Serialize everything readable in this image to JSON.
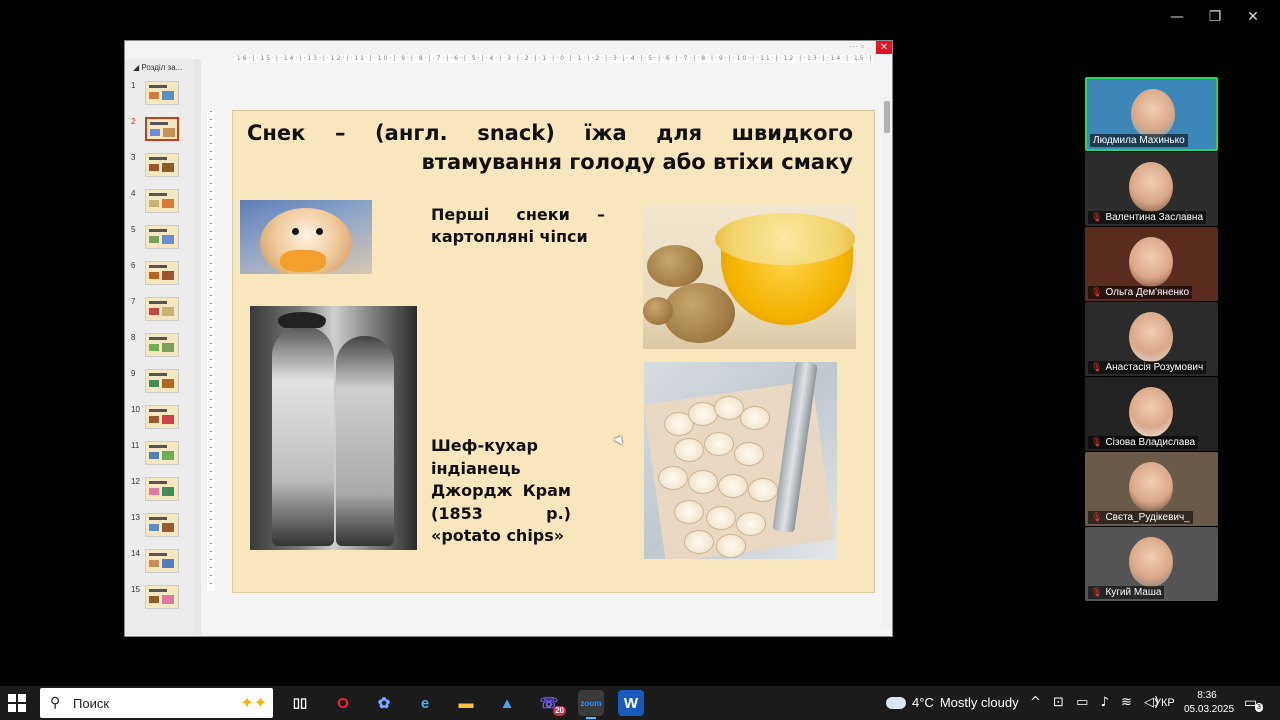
{
  "window_controls": {
    "minimize": "—",
    "maximize": "❐",
    "close": "✕"
  },
  "ppt": {
    "close_icon": "✕",
    "section_label": "Розділ за...",
    "slides": [
      "1",
      "2",
      "3",
      "4",
      "5",
      "6",
      "7",
      "8",
      "9",
      "10",
      "11",
      "12",
      "13",
      "14",
      "15"
    ],
    "active_slide": "2",
    "ruler_text": "·16·|·15·|·14·|·13·|·12·|·11·|·10·|·9·|·8·|·7·|·6·|·5·|·4·|·3·|·2·|·1·|·0·|·1·|·2·|·3·|·4·|·5·|·6·|·7·|·8·|·9·|·10·|·11·|·12·|·13·|·14·|·15·|·16·"
  },
  "slide": {
    "title": "Снек – (англ. snack) їжа для швидкого втамування голоду або втіхи смаку",
    "text1": "Перші снеки – картопляні чіпси",
    "text2": "Шеф-кухар індіанець Джордж Крам (1853 р.) «potato chips»",
    "bg_color": "#f8e7bd"
  },
  "participants": [
    {
      "name": "Людмила Махинько",
      "muted": false,
      "active": true
    },
    {
      "name": "Валентина Заславна",
      "muted": true,
      "active": false
    },
    {
      "name": "Ольга Дем'яненко",
      "muted": true,
      "active": false
    },
    {
      "name": "Анастасія Розумович",
      "muted": true,
      "active": false
    },
    {
      "name": "Сізова Владислава",
      "muted": true,
      "active": false
    },
    {
      "name": "Свєта_Рудікевич_",
      "muted": true,
      "active": false
    },
    {
      "name": "Кугий Маша",
      "muted": true,
      "active": false
    }
  ],
  "taskbar": {
    "search_placeholder": "Поиск",
    "weather_temp": "4°C",
    "weather_desc": "Mostly cloudy",
    "language": "УКР",
    "time": "8:36",
    "date": "05.03.2025",
    "notification_count": "3",
    "viber_badge": "20"
  }
}
